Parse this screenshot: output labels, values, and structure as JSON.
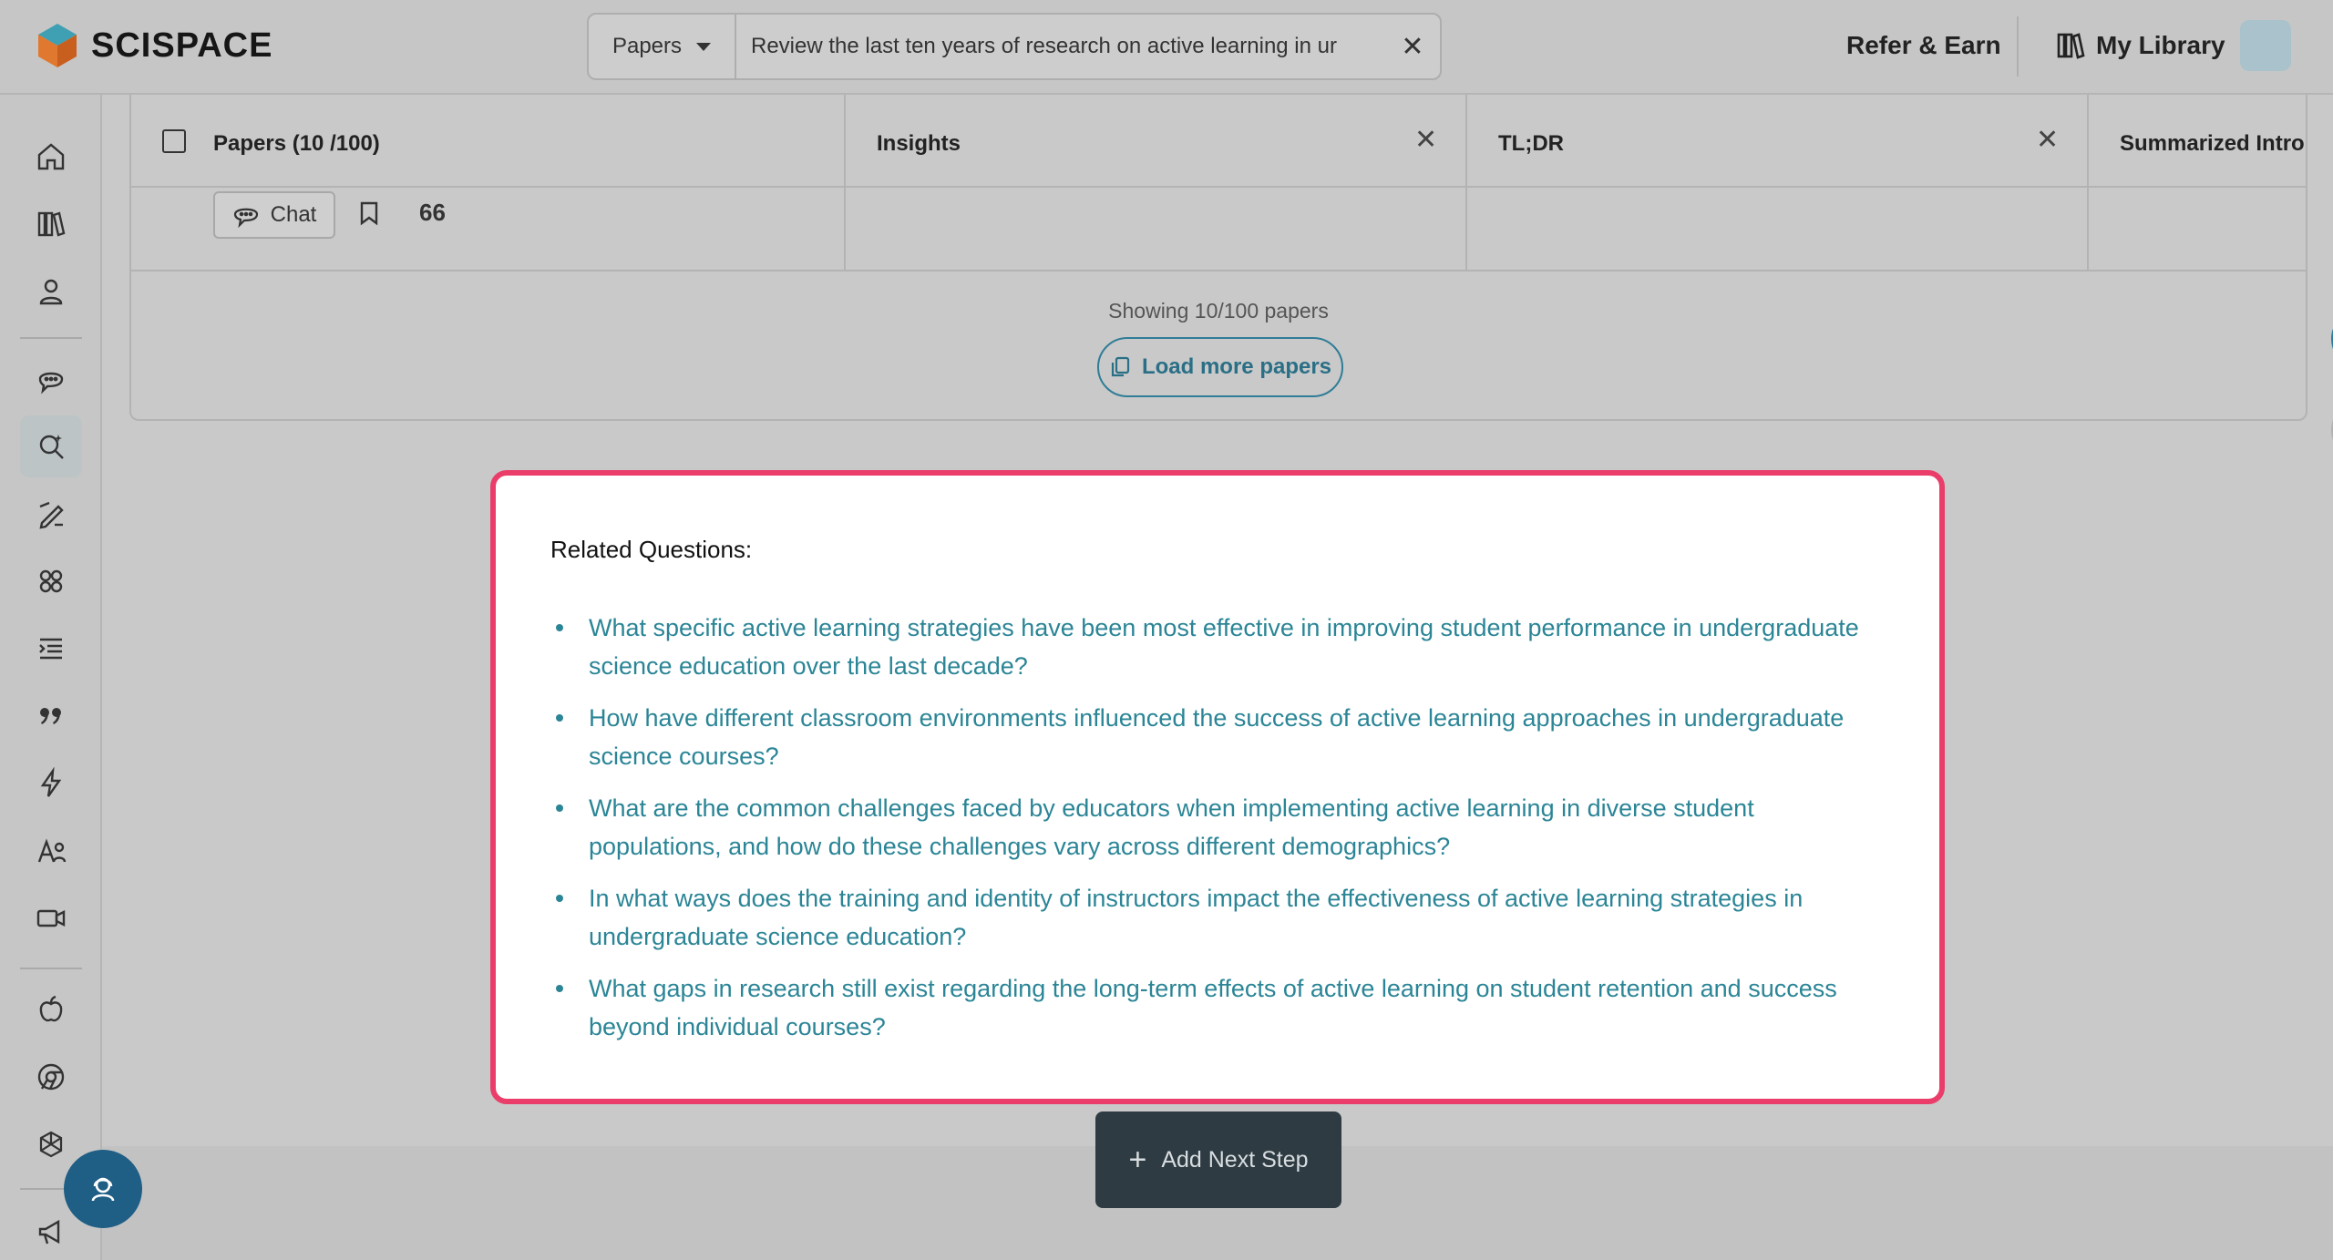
{
  "app": {
    "brand": "SCISPACE"
  },
  "search": {
    "type_label": "Papers",
    "query": "Review the last ten years of research on active learning in ur"
  },
  "header": {
    "refer_label": "Refer & Earn",
    "library_label": "My Library"
  },
  "table": {
    "columns": [
      {
        "title": "Papers (10 /100)"
      },
      {
        "title": "Insights"
      },
      {
        "title": "TL;DR"
      },
      {
        "title": "Summarized Intro"
      }
    ],
    "row": {
      "chat_label": "Chat",
      "citations": "66"
    },
    "showing_text": "Showing 10/100 papers",
    "load_more_label": "Load more papers"
  },
  "related": {
    "heading": "Related Questions:",
    "questions": [
      "What specific active learning strategies have been most effective in improving student performance in undergraduate science education over the last decade?",
      "How have different classroom environments influenced the success of active learning approaches in undergraduate science courses?",
      "What are the common challenges faced by educators when implementing active learning in diverse student populations, and how do these challenges vary across different demographics?",
      "In what ways does the training and identity of instructors impact the effectiveness of active learning strategies in undergraduate science education?",
      "What gaps in research still exist regarding the long-term effects of active learning on student retention and success beyond individual courses?"
    ]
  },
  "footer": {
    "add_step_label": "Add Next Step"
  },
  "colors": {
    "accent": "#2b8596",
    "highlight_border": "#ea3d6a",
    "dark_button": "#2e3b42",
    "fab": "#1f5e85"
  }
}
